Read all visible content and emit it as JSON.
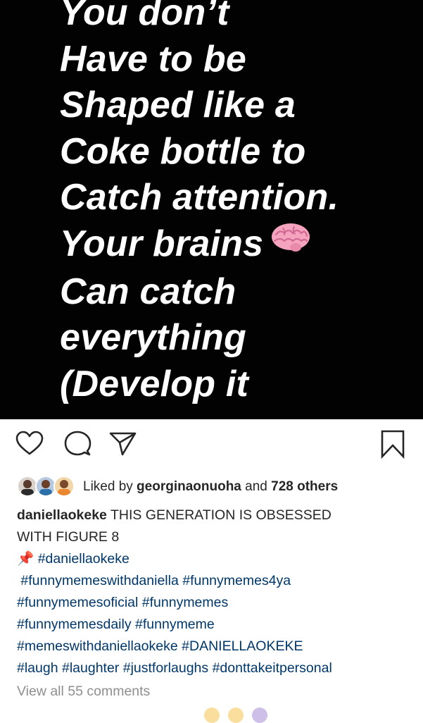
{
  "post": {
    "image_text_lines": [
      "You don’t",
      "Have to be",
      "Shaped like a",
      "Coke bottle to",
      "Catch attention.",
      "Your brains",
      "Can catch",
      "everything",
      "(Develop it"
    ],
    "image_emoji": "brain-emoji"
  },
  "actions": {
    "like_icon": "heart-icon",
    "comment_icon": "comment-icon",
    "share_icon": "paper-plane-icon",
    "save_icon": "bookmark-icon"
  },
  "likes": {
    "prefix": "Liked by ",
    "user": "georginaonuoha",
    "middle": " and ",
    "others": "728 others"
  },
  "caption": {
    "username": "daniellaokeke",
    "text_line1": " THIS GENERATION IS OBSESSED",
    "text_line2": "WITH FIGURE 8",
    "pin_emoji": "📌",
    "tags_line1": [
      "#daniellaokeke"
    ],
    "tags_line2": [
      "#funnymemeswithdaniella",
      "#funnymemes4ya"
    ],
    "tags_line3": [
      "#funnymemesoficial",
      "#funnymemes"
    ],
    "tags_line4": [
      "#funnymemesdaily",
      "#funnymeme"
    ],
    "tags_line5": [
      "#memeswithdaniellaokeke",
      "#DANIELLAOKEKE"
    ],
    "tags_line6": [
      "#laugh",
      "#laughter",
      "#justforlaughs",
      "#donttakeitpersonal"
    ]
  },
  "comments": {
    "view_all": "View all 55 comments"
  },
  "colors": {
    "image_bg": "#020202",
    "hashtag": "#00376b",
    "muted": "#8e8e8e"
  }
}
